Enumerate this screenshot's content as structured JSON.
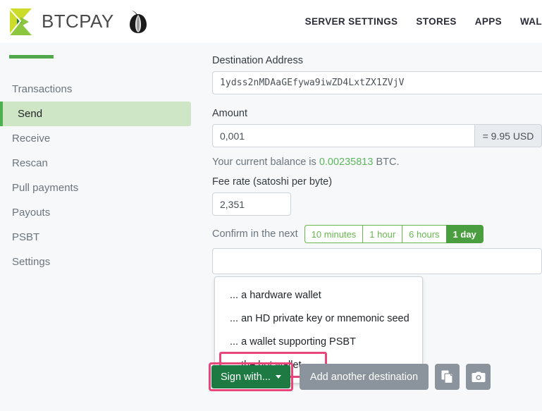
{
  "header": {
    "brand_name": "BTCPAY",
    "logo_icon": "btcpay-logo-icon",
    "tor_icon": "tor-onion-icon",
    "nav": [
      {
        "label": "SERVER SETTINGS",
        "name": "nav-server-settings"
      },
      {
        "label": "STORES",
        "name": "nav-stores"
      },
      {
        "label": "APPS",
        "name": "nav-apps"
      },
      {
        "label": "WAL",
        "name": "nav-wallets"
      }
    ]
  },
  "sidebar": {
    "items": [
      {
        "label": "Transactions",
        "active": false
      },
      {
        "label": "Send",
        "active": true
      },
      {
        "label": "Receive",
        "active": false
      },
      {
        "label": "Rescan",
        "active": false
      },
      {
        "label": "Pull payments",
        "active": false
      },
      {
        "label": "Payouts",
        "active": false
      },
      {
        "label": "PSBT",
        "active": false
      },
      {
        "label": "Settings",
        "active": false
      }
    ]
  },
  "form": {
    "destination_label": "Destination Address",
    "destination_value": "1ydss2nMDAaGEfywa9iwZD4LxtZX1ZVjV",
    "amount_label": "Amount",
    "amount_value": "0,001",
    "amount_fiat": "= 9.95 USD",
    "balance_prefix": "Your current balance is",
    "balance_value": "0.00235813",
    "balance_suffix": "BTC.",
    "fee_label": "Fee rate (satoshi per byte)",
    "fee_value": "2,351",
    "confirm_label": "Confirm in the next",
    "confirm_options": [
      {
        "label": "10 minutes",
        "active": false
      },
      {
        "label": "1 hour",
        "active": false
      },
      {
        "label": "6 hours",
        "active": false
      },
      {
        "label": "1 day",
        "active": true
      }
    ]
  },
  "dropdown": {
    "items": [
      {
        "label": "... a hardware wallet",
        "highlighted": false
      },
      {
        "label": "... an HD private key or mnemonic seed",
        "highlighted": false
      },
      {
        "label": "... a wallet supporting PSBT",
        "highlighted": false
      },
      {
        "label": "... the hot wallet",
        "highlighted": true
      }
    ]
  },
  "actions": {
    "sign_label": "Sign with...",
    "add_destination_label": "Add another destination",
    "paste_icon": "paste-clipboard-icon",
    "camera_icon": "camera-icon"
  },
  "colors": {
    "accent_green": "#51a84c",
    "active_green": "#4a9e3f",
    "sign_green": "#1d7a43",
    "highlight_pink": "#e8457a",
    "balance_green": "#5cb85c",
    "gray_button": "#8b949c"
  }
}
